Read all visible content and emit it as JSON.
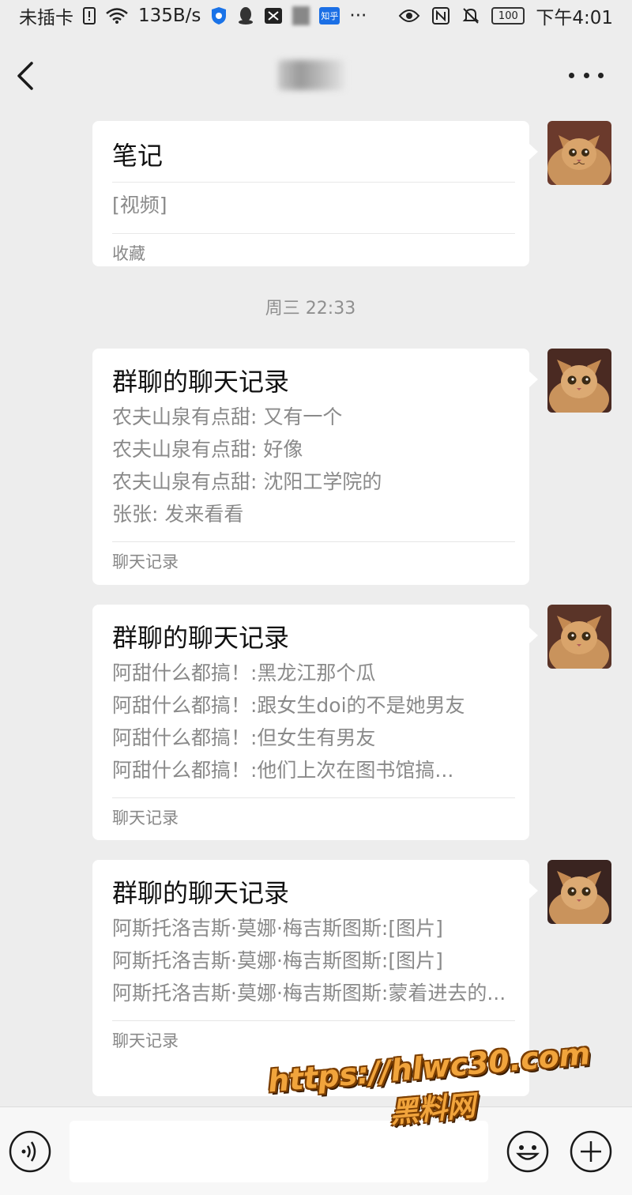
{
  "status_bar": {
    "carrier": "未插卡",
    "speed": "135B/s",
    "more": "···",
    "battery": "100",
    "time": "下午4:01",
    "zhihu_label": "知乎",
    "icons": [
      "sim-icon",
      "wifi-icon",
      "shield-icon",
      "qq-icon",
      "capcut-icon",
      "zhihu-icon",
      "eye-icon",
      "nfc-icon",
      "mute-icon",
      "battery-icon"
    ]
  },
  "header": {
    "back_icon": "chevron-left-icon",
    "more_icon": "more-dots-icon"
  },
  "messages": {
    "note": {
      "title": "笔记",
      "body": "[视频]",
      "footer": "收藏"
    },
    "timestamp": "周三 22:33",
    "chat1": {
      "title": "群聊的聊天记录",
      "lines": [
        "农夫山泉有点甜: 又有一个",
        "农夫山泉有点甜: 好像",
        "农夫山泉有点甜: 沈阳工学院的",
        "张张: 发来看看"
      ],
      "footer": "聊天记录"
    },
    "chat2": {
      "title": "群聊的聊天记录",
      "lines": [
        "阿甜什么都搞！:黑龙江那个瓜",
        "阿甜什么都搞！:跟女生doi的不是她男友",
        "阿甜什么都搞！:但女生有男友",
        "阿甜什么都搞！:他们上次在图书馆搞..."
      ],
      "footer": "聊天记录"
    },
    "chat3": {
      "title": "群聊的聊天记录",
      "lines": [
        "阿斯托洛吉斯·莫娜·梅吉斯图斯:[图片]",
        "阿斯托洛吉斯·莫娜·梅吉斯图斯:[图片]",
        "阿斯托洛吉斯·莫娜·梅吉斯图斯:蒙着进去的..."
      ],
      "footer": "聊天记录"
    }
  },
  "input_bar": {
    "placeholder": "",
    "voice_icon": "voice-icon",
    "emoji_icon": "emoji-icon",
    "plus_icon": "plus-icon"
  },
  "watermark": {
    "url": "https://hlwc30.com",
    "name": "黑料网"
  },
  "colors": {
    "background": "#ededed",
    "bubble": "#ffffff",
    "watermark": "#f1a43c"
  }
}
